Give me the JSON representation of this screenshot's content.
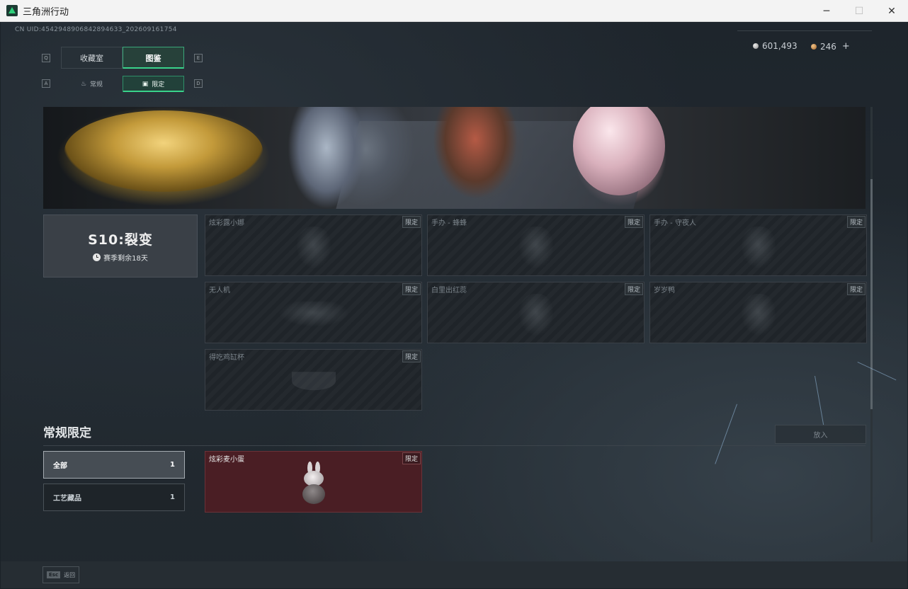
{
  "window": {
    "title": "三角洲行动",
    "minimize": "─",
    "maximize": "☐",
    "close": "✕"
  },
  "header": {
    "uid": "CN UID:4542948906842894633_202609161754",
    "currency": [
      {
        "amount": "601,493",
        "icon": "silver-coin-icon"
      },
      {
        "amount": "246",
        "icon": "gold-coin-icon",
        "add": "+"
      }
    ]
  },
  "tabs": {
    "key_left": "Q",
    "key_right": "E",
    "items": [
      {
        "label": "收藏室",
        "active": false
      },
      {
        "label": "图鉴",
        "active": true
      }
    ]
  },
  "subtabs": {
    "key_left": "A",
    "key_right": "D",
    "items": [
      {
        "label": "常规",
        "icon": "flame-icon",
        "active": false
      },
      {
        "label": "限定",
        "icon": "image-icon",
        "active": true
      }
    ]
  },
  "season": {
    "title": "S10:裂变",
    "remaining": "赛季剩余18天"
  },
  "season_items": [
    {
      "name": "炫彩露小娜",
      "badge": "限定"
    },
    {
      "name": "手办 - 蜂蜂",
      "badge": "限定"
    },
    {
      "name": "手办 - 守夜人",
      "badge": "限定"
    },
    {
      "name": "无人机",
      "badge": "限定"
    },
    {
      "name": "白里出红蕊",
      "badge": "限定"
    },
    {
      "name": "岁岁鸭",
      "badge": "限定"
    },
    {
      "name": "得吃鸡缸杯",
      "badge": "限定"
    }
  ],
  "regular": {
    "title": "常规限定",
    "put_button": "放入",
    "filters": [
      {
        "label": "全部",
        "count": "1",
        "active": true
      },
      {
        "label": "工艺藏品",
        "count": "1",
        "active": false
      }
    ],
    "items": [
      {
        "name": "炫彩麦小蛋",
        "badge": "限定"
      }
    ]
  },
  "footer": {
    "esc_key": "Esc",
    "esc_label": "返回"
  },
  "colors": {
    "accent": "#39d38b",
    "owned_card": "#4a1e24",
    "background": "#1e252c"
  }
}
